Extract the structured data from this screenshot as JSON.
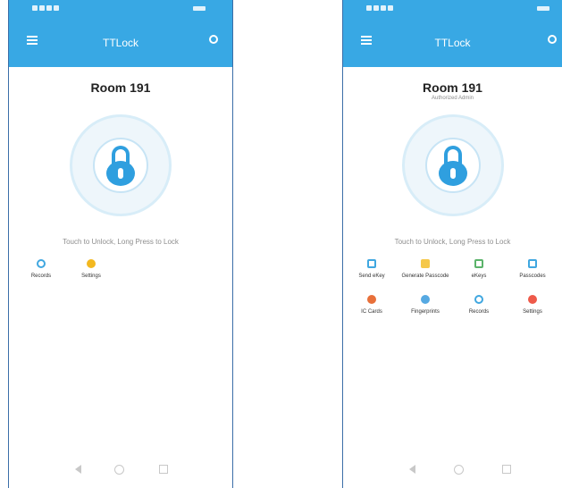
{
  "app": {
    "title": "TTLock"
  },
  "left_screen": {
    "room_name": "Room 191",
    "hint": "Touch to Unlock, Long Press to Lock",
    "actions": [
      {
        "label": "Records",
        "icon": "records-icon"
      },
      {
        "label": "Settings",
        "icon": "settings-icon"
      }
    ]
  },
  "right_screen": {
    "room_name": "Room 191",
    "subtitle": "Authorized Admin",
    "hint": "Touch to Unlock, Long Press to Lock",
    "actions_row1": [
      {
        "label": "Send eKey",
        "icon": "send-ekey-icon"
      },
      {
        "label": "Generate Passcode",
        "icon": "generate-passcode-icon"
      },
      {
        "label": "eKeys",
        "icon": "ekeys-icon"
      },
      {
        "label": "Passcodes",
        "icon": "passcodes-icon"
      }
    ],
    "actions_row2": [
      {
        "label": "IC Cards",
        "icon": "ic-cards-icon"
      },
      {
        "label": "Fingerprints",
        "icon": "fingerprints-icon"
      },
      {
        "label": "Records",
        "icon": "records-icon"
      },
      {
        "label": "Settings",
        "icon": "settings-icon"
      }
    ]
  },
  "colors": {
    "accent": "#38a8e4",
    "lock": "#2f9fdf"
  }
}
